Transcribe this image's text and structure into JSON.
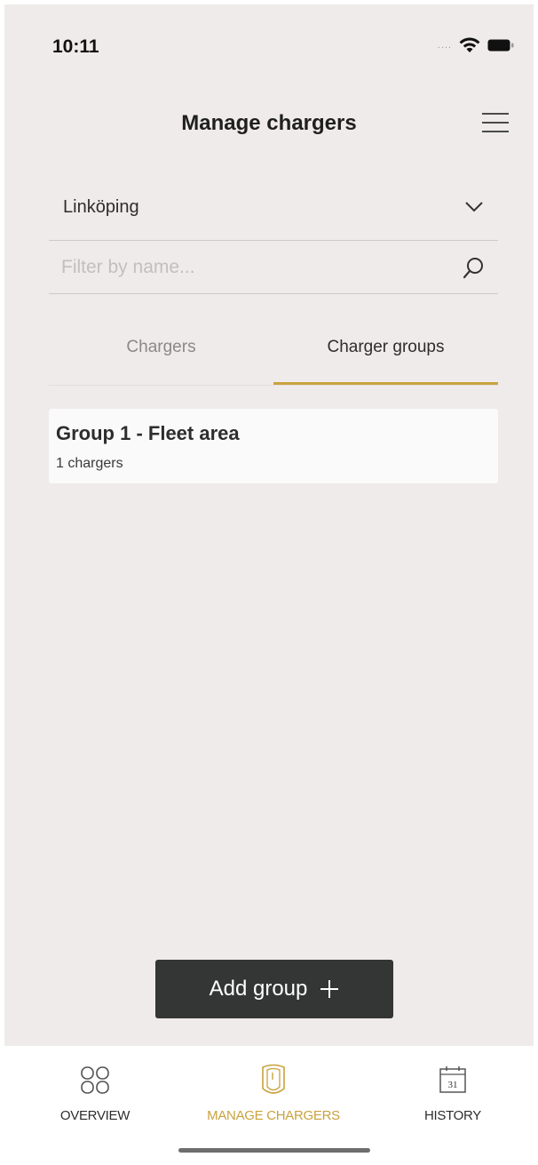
{
  "status_bar": {
    "time": "10:11",
    "signal": "....",
    "icons": [
      "wifi-icon",
      "battery-icon"
    ]
  },
  "header": {
    "title": "Manage chargers",
    "menu_icon": "hamburger-menu-icon"
  },
  "location": {
    "selected": "Linköping",
    "icon": "chevron-down-icon"
  },
  "search": {
    "placeholder": "Filter by name...",
    "value": "",
    "icon": "search-icon"
  },
  "tabs": [
    {
      "label": "Chargers",
      "active": false
    },
    {
      "label": "Charger groups",
      "active": true
    }
  ],
  "groups": [
    {
      "name": "Group 1 - Fleet area",
      "count_label": "1 chargers"
    }
  ],
  "add_group": {
    "label": "Add group",
    "icon": "plus-icon"
  },
  "bottom_nav": {
    "items": [
      {
        "label": "OVERVIEW",
        "icon": "overview-grid-icon",
        "active": false
      },
      {
        "label": "MANAGE CHARGERS",
        "icon": "charger-icon",
        "active": true
      },
      {
        "label": "HISTORY",
        "icon": "calendar-icon",
        "active": false,
        "calendar_day": "31"
      }
    ]
  },
  "colors": {
    "background": "#efebea",
    "accent": "#c9a23e",
    "button": "#343535",
    "card": "#fafafa"
  }
}
